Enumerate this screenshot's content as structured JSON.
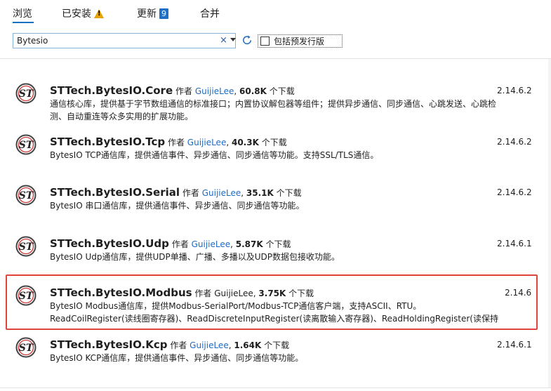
{
  "tabs": [
    {
      "label": "浏览"
    },
    {
      "label": "已安装"
    },
    {
      "label": "更新",
      "badge": "9"
    },
    {
      "label": "合并"
    }
  ],
  "search": {
    "value": "Bytesio",
    "clear_glyph": "×"
  },
  "prerelease_label": "包括预发行版",
  "author_prefix": "作者",
  "downloads_suffix": "个下载",
  "packages": [
    {
      "name": "STTech.BytesIO.Core",
      "author": "GuijieLee",
      "downloads": "60.8K",
      "version": "2.14.6.2",
      "desc": "通信核心库，提供基于字节数组通信的标准接口；内置协议解包器等组件；提供异步通信、同步通信、心跳发送、心跳检测、自动重连等众多实用的扩展功能。"
    },
    {
      "name": "STTech.BytesIO.Tcp",
      "author": "GuijieLee",
      "downloads": "40.3K",
      "version": "2.14.6.2",
      "desc": "BytesIO TCP通信库，提供通信事件、异步通信、同步通信等功能。支持SSL/TLS通信。"
    },
    {
      "name": "STTech.BytesIO.Serial",
      "author": "GuijieLee",
      "downloads": "35.1K",
      "version": "2.14.6.2",
      "desc": "BytesIO 串口通信库，提供通信事件、异步通信、同步通信等功能。"
    },
    {
      "name": "STTech.BytesIO.Udp",
      "author": "GuijieLee",
      "downloads": "5.87K",
      "version": "2.14.6.1",
      "desc": "BytesIO Udp通信库，提供UDP单播、广播、多播以及UDP数据包接收功能。"
    },
    {
      "name": "STTech.BytesIO.Modbus",
      "author": "GuijieLee",
      "downloads": "3.75K",
      "version": "2.14.6",
      "desc": "BytesIO Modbus通信库，提供Modbus-SerialPort/Modbus-TCP通信客户端，支持ASCII、RTU。ReadCoilRegister(读线圈寄存器)、ReadDiscreteInputRegister(读离散输入寄存器)、ReadHoldingRegister(读保持寄存器)、ReadIn…"
    },
    {
      "name": "STTech.BytesIO.Kcp",
      "author": "GuijieLee",
      "downloads": "1.64K",
      "version": "2.14.6.1",
      "desc": "BytesIO KCP通信库，提供通信事件、异步通信、同步通信等功能。"
    }
  ],
  "colors": {
    "accent": "#0e70c0",
    "link": "#1e6bc4",
    "selection_border": "#e0443c",
    "badge_bg": "#1f6fc5"
  }
}
